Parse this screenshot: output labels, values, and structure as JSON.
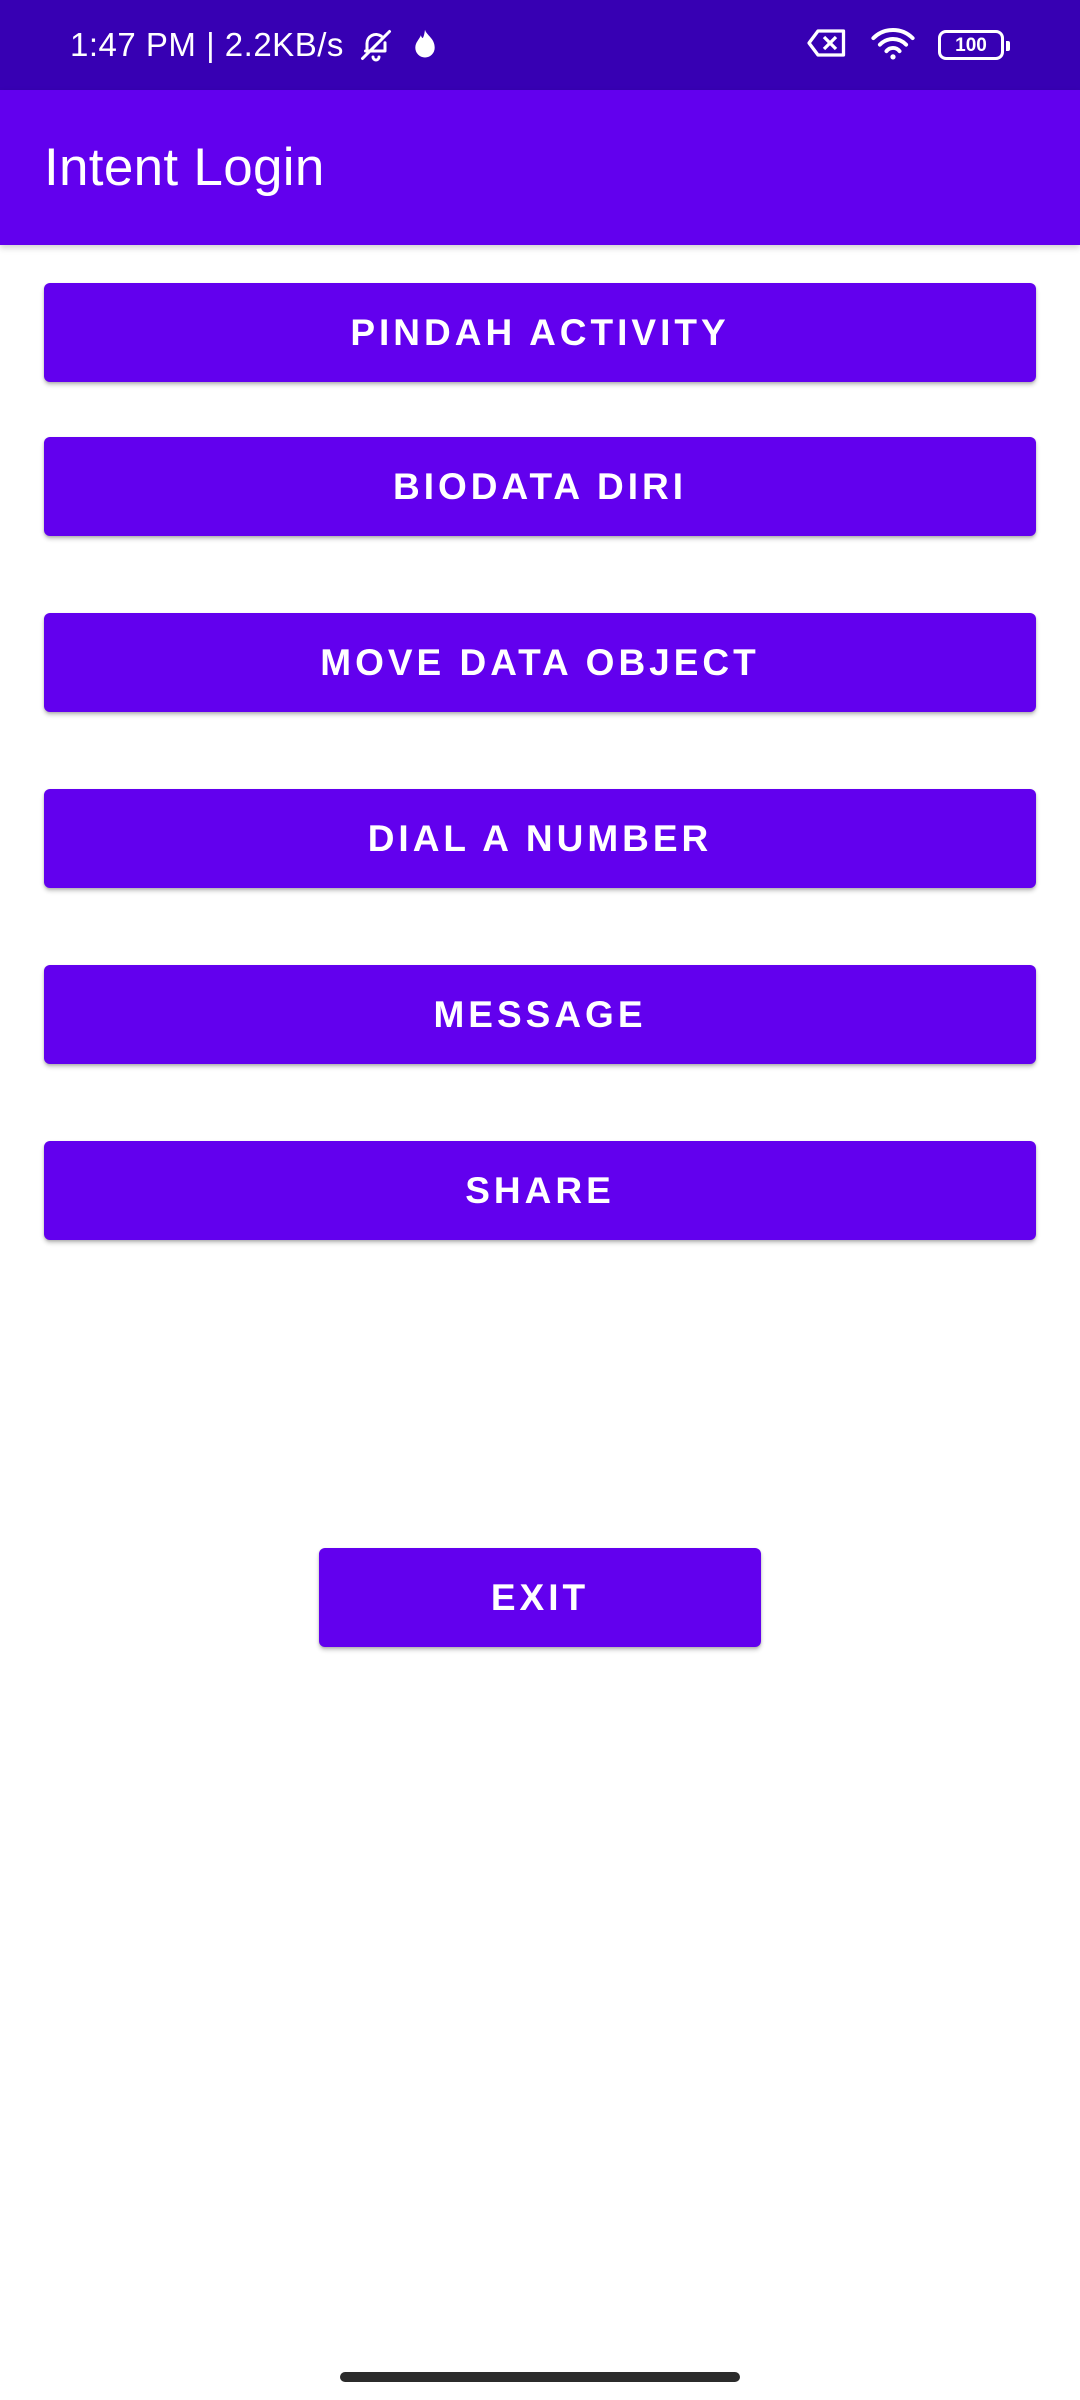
{
  "status_bar": {
    "time_speed": "1:47 PM | 2.2KB/s",
    "battery": "100",
    "icons": [
      "bell-off-icon",
      "flame-icon",
      "sim-x-icon",
      "wifi-icon",
      "battery-icon"
    ]
  },
  "app_bar": {
    "title": "Intent Login"
  },
  "buttons": {
    "pindah_activity": "PINDAH ACTIVITY",
    "biodata_diri": "BIODATA DIRI",
    "move_data_object": "MOVE DATA OBJECT",
    "dial_a_number": "DIAL A NUMBER",
    "message": "MESSAGE",
    "share": "SHARE",
    "exit": "EXIT"
  },
  "colors": {
    "status_bar": "#3700b3",
    "primary": "#6200ee",
    "background": "#ffffff",
    "on_primary": "#ffffff"
  }
}
